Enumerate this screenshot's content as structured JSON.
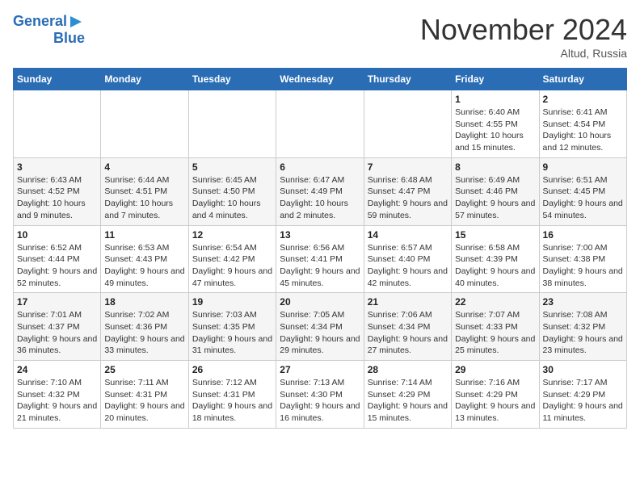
{
  "header": {
    "logo_line1": "General",
    "logo_line2": "Blue",
    "month_title": "November 2024",
    "location": "Altud, Russia"
  },
  "weekdays": [
    "Sunday",
    "Monday",
    "Tuesday",
    "Wednesday",
    "Thursday",
    "Friday",
    "Saturday"
  ],
  "weeks": [
    [
      {
        "day": "",
        "info": ""
      },
      {
        "day": "",
        "info": ""
      },
      {
        "day": "",
        "info": ""
      },
      {
        "day": "",
        "info": ""
      },
      {
        "day": "",
        "info": ""
      },
      {
        "day": "1",
        "info": "Sunrise: 6:40 AM\nSunset: 4:55 PM\nDaylight: 10 hours and 15 minutes."
      },
      {
        "day": "2",
        "info": "Sunrise: 6:41 AM\nSunset: 4:54 PM\nDaylight: 10 hours and 12 minutes."
      }
    ],
    [
      {
        "day": "3",
        "info": "Sunrise: 6:43 AM\nSunset: 4:52 PM\nDaylight: 10 hours and 9 minutes."
      },
      {
        "day": "4",
        "info": "Sunrise: 6:44 AM\nSunset: 4:51 PM\nDaylight: 10 hours and 7 minutes."
      },
      {
        "day": "5",
        "info": "Sunrise: 6:45 AM\nSunset: 4:50 PM\nDaylight: 10 hours and 4 minutes."
      },
      {
        "day": "6",
        "info": "Sunrise: 6:47 AM\nSunset: 4:49 PM\nDaylight: 10 hours and 2 minutes."
      },
      {
        "day": "7",
        "info": "Sunrise: 6:48 AM\nSunset: 4:47 PM\nDaylight: 9 hours and 59 minutes."
      },
      {
        "day": "8",
        "info": "Sunrise: 6:49 AM\nSunset: 4:46 PM\nDaylight: 9 hours and 57 minutes."
      },
      {
        "day": "9",
        "info": "Sunrise: 6:51 AM\nSunset: 4:45 PM\nDaylight: 9 hours and 54 minutes."
      }
    ],
    [
      {
        "day": "10",
        "info": "Sunrise: 6:52 AM\nSunset: 4:44 PM\nDaylight: 9 hours and 52 minutes."
      },
      {
        "day": "11",
        "info": "Sunrise: 6:53 AM\nSunset: 4:43 PM\nDaylight: 9 hours and 49 minutes."
      },
      {
        "day": "12",
        "info": "Sunrise: 6:54 AM\nSunset: 4:42 PM\nDaylight: 9 hours and 47 minutes."
      },
      {
        "day": "13",
        "info": "Sunrise: 6:56 AM\nSunset: 4:41 PM\nDaylight: 9 hours and 45 minutes."
      },
      {
        "day": "14",
        "info": "Sunrise: 6:57 AM\nSunset: 4:40 PM\nDaylight: 9 hours and 42 minutes."
      },
      {
        "day": "15",
        "info": "Sunrise: 6:58 AM\nSunset: 4:39 PM\nDaylight: 9 hours and 40 minutes."
      },
      {
        "day": "16",
        "info": "Sunrise: 7:00 AM\nSunset: 4:38 PM\nDaylight: 9 hours and 38 minutes."
      }
    ],
    [
      {
        "day": "17",
        "info": "Sunrise: 7:01 AM\nSunset: 4:37 PM\nDaylight: 9 hours and 36 minutes."
      },
      {
        "day": "18",
        "info": "Sunrise: 7:02 AM\nSunset: 4:36 PM\nDaylight: 9 hours and 33 minutes."
      },
      {
        "day": "19",
        "info": "Sunrise: 7:03 AM\nSunset: 4:35 PM\nDaylight: 9 hours and 31 minutes."
      },
      {
        "day": "20",
        "info": "Sunrise: 7:05 AM\nSunset: 4:34 PM\nDaylight: 9 hours and 29 minutes."
      },
      {
        "day": "21",
        "info": "Sunrise: 7:06 AM\nSunset: 4:34 PM\nDaylight: 9 hours and 27 minutes."
      },
      {
        "day": "22",
        "info": "Sunrise: 7:07 AM\nSunset: 4:33 PM\nDaylight: 9 hours and 25 minutes."
      },
      {
        "day": "23",
        "info": "Sunrise: 7:08 AM\nSunset: 4:32 PM\nDaylight: 9 hours and 23 minutes."
      }
    ],
    [
      {
        "day": "24",
        "info": "Sunrise: 7:10 AM\nSunset: 4:32 PM\nDaylight: 9 hours and 21 minutes."
      },
      {
        "day": "25",
        "info": "Sunrise: 7:11 AM\nSunset: 4:31 PM\nDaylight: 9 hours and 20 minutes."
      },
      {
        "day": "26",
        "info": "Sunrise: 7:12 AM\nSunset: 4:31 PM\nDaylight: 9 hours and 18 minutes."
      },
      {
        "day": "27",
        "info": "Sunrise: 7:13 AM\nSunset: 4:30 PM\nDaylight: 9 hours and 16 minutes."
      },
      {
        "day": "28",
        "info": "Sunrise: 7:14 AM\nSunset: 4:29 PM\nDaylight: 9 hours and 15 minutes."
      },
      {
        "day": "29",
        "info": "Sunrise: 7:16 AM\nSunset: 4:29 PM\nDaylight: 9 hours and 13 minutes."
      },
      {
        "day": "30",
        "info": "Sunrise: 7:17 AM\nSunset: 4:29 PM\nDaylight: 9 hours and 11 minutes."
      }
    ]
  ]
}
